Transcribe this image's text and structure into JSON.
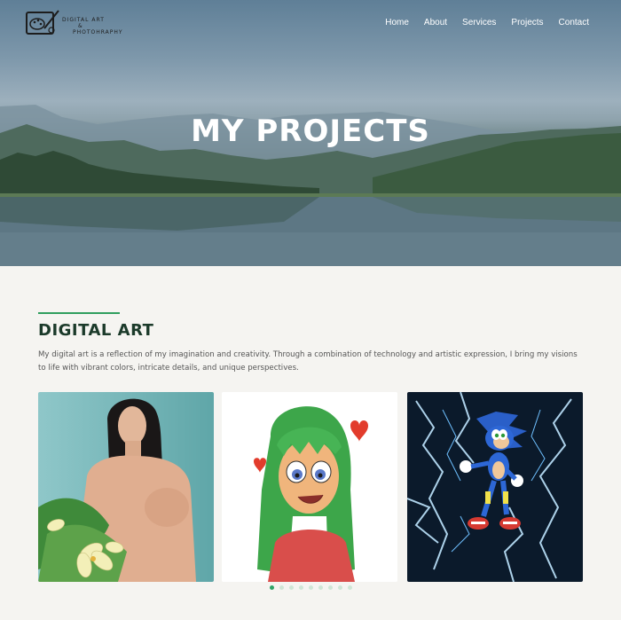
{
  "logo": {
    "line1": "DIGITAL ART",
    "line2": "&",
    "line3": "PHOTOHRAPHY"
  },
  "nav": {
    "items": [
      "Home",
      "About",
      "Services",
      "Projects",
      "Contact"
    ]
  },
  "hero": {
    "title": "MY PROJECTS"
  },
  "section": {
    "title": "DIGITAL ART",
    "description": "My digital art is a reflection of my imagination and creativity. Through a combination of technology and artistic expression, I bring my visions to life with vibrant colors, intricate details, and unique perspectives."
  },
  "gallery": {
    "slide_count": 9,
    "active_index": 0
  },
  "colors": {
    "accent": "#2f9e5e",
    "title": "#1b3a2a",
    "background": "#f5f4f1"
  }
}
